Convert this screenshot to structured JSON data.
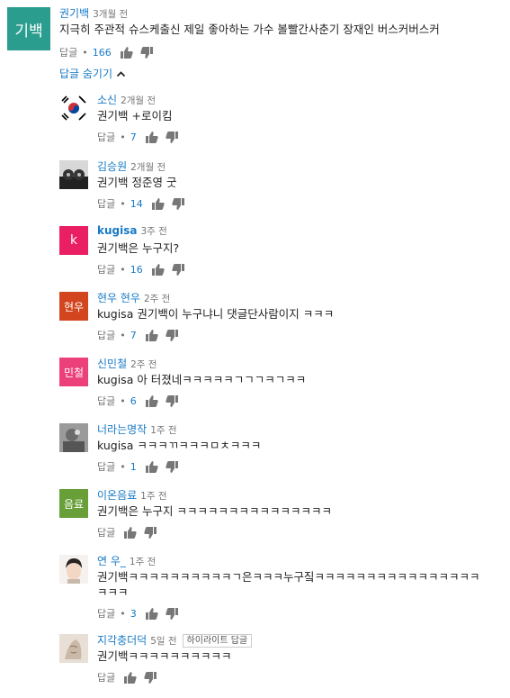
{
  "top_comment": {
    "avatar_text": "기백",
    "avatar_color": "#2a9d8f",
    "author": "권기백",
    "time": "3개월 전",
    "text": "지극히 주관적 슈스케출신 제일 좋아하는 가수 볼빨간사춘기 장재인 버스커버스커",
    "reply_label": "답글",
    "likes": "166"
  },
  "hide_replies_label": "답글 숨기기",
  "replies": [
    {
      "avatar_text": "",
      "avatar_kind": "flag-kr",
      "author": "소신",
      "time": "2개월 전",
      "text": "권기백 +로이킴",
      "reply_label": "답글",
      "likes": "7"
    },
    {
      "avatar_text": "",
      "avatar_kind": "photo-dark",
      "author": "김승원",
      "time": "2개월 전",
      "text": "권기백 정준영 굿",
      "reply_label": "답글",
      "likes": "14"
    },
    {
      "avatar_text": "k",
      "avatar_color": "#e91e63",
      "author": "kugisa",
      "time": "3주 전",
      "text": "권기백은 누구지?",
      "reply_label": "답글",
      "likes": "16"
    },
    {
      "avatar_text": "현우",
      "avatar_color": "#d2451e",
      "author": "현우 현우",
      "time": "2주 전",
      "text": "kugisa 권기백이 누구냐니 댓글단사람이지 ㅋㅋㅋ",
      "reply_label": "답글",
      "likes": "7"
    },
    {
      "avatar_text": "민철",
      "avatar_color": "#ec407a",
      "author": "신민철",
      "time": "2주 전",
      "text": "kugisa 아 터졌네ㅋㅋㅋㅋㅋㄱㄱㄱㅋㄱㅋㅋ",
      "reply_label": "답글",
      "likes": "6"
    },
    {
      "avatar_text": "",
      "avatar_kind": "photo-gray",
      "author": "너라는명작",
      "time": "1주 전",
      "text": "kugisa ㅋㅋㅋㄲㅋㅋㅋㅁㅊㅋㅋㅋ",
      "reply_label": "답글",
      "likes": "1"
    },
    {
      "avatar_text": "음료",
      "avatar_color": "#689f38",
      "author": "이온음료",
      "time": "1주 전",
      "text": "권기백은 누구지 ㅋㅋㅋㅋㅋㅋㅋㅋㅋㅋㅋㅋㅋㅋㅋ",
      "reply_label": "답글",
      "likes": ""
    },
    {
      "avatar_text": "",
      "avatar_kind": "photo-face",
      "author": "연 우_",
      "time": "1주 전",
      "text": "권기백ㅋㅋㅋㅋㅋㅋㅋㅋㅋㅋㄱ은ㅋㅋㅋ누구짘ㅋㅋㅋㅋㅋㅋㅋㅋㅋㅋㅋㅋㅋㅋㅋㅋ\nㅋㅋㅋ",
      "reply_label": "답글",
      "likes": "3"
    },
    {
      "avatar_text": "",
      "avatar_kind": "photo-sketch",
      "author": "지각충더덕",
      "time": "5일 전",
      "badge": "하이라이트 답글",
      "text": "권기백ㅋㅋㅋㅋㅋㅋㅋㅋㅋㅋ",
      "reply_label": "답글",
      "likes": ""
    }
  ]
}
